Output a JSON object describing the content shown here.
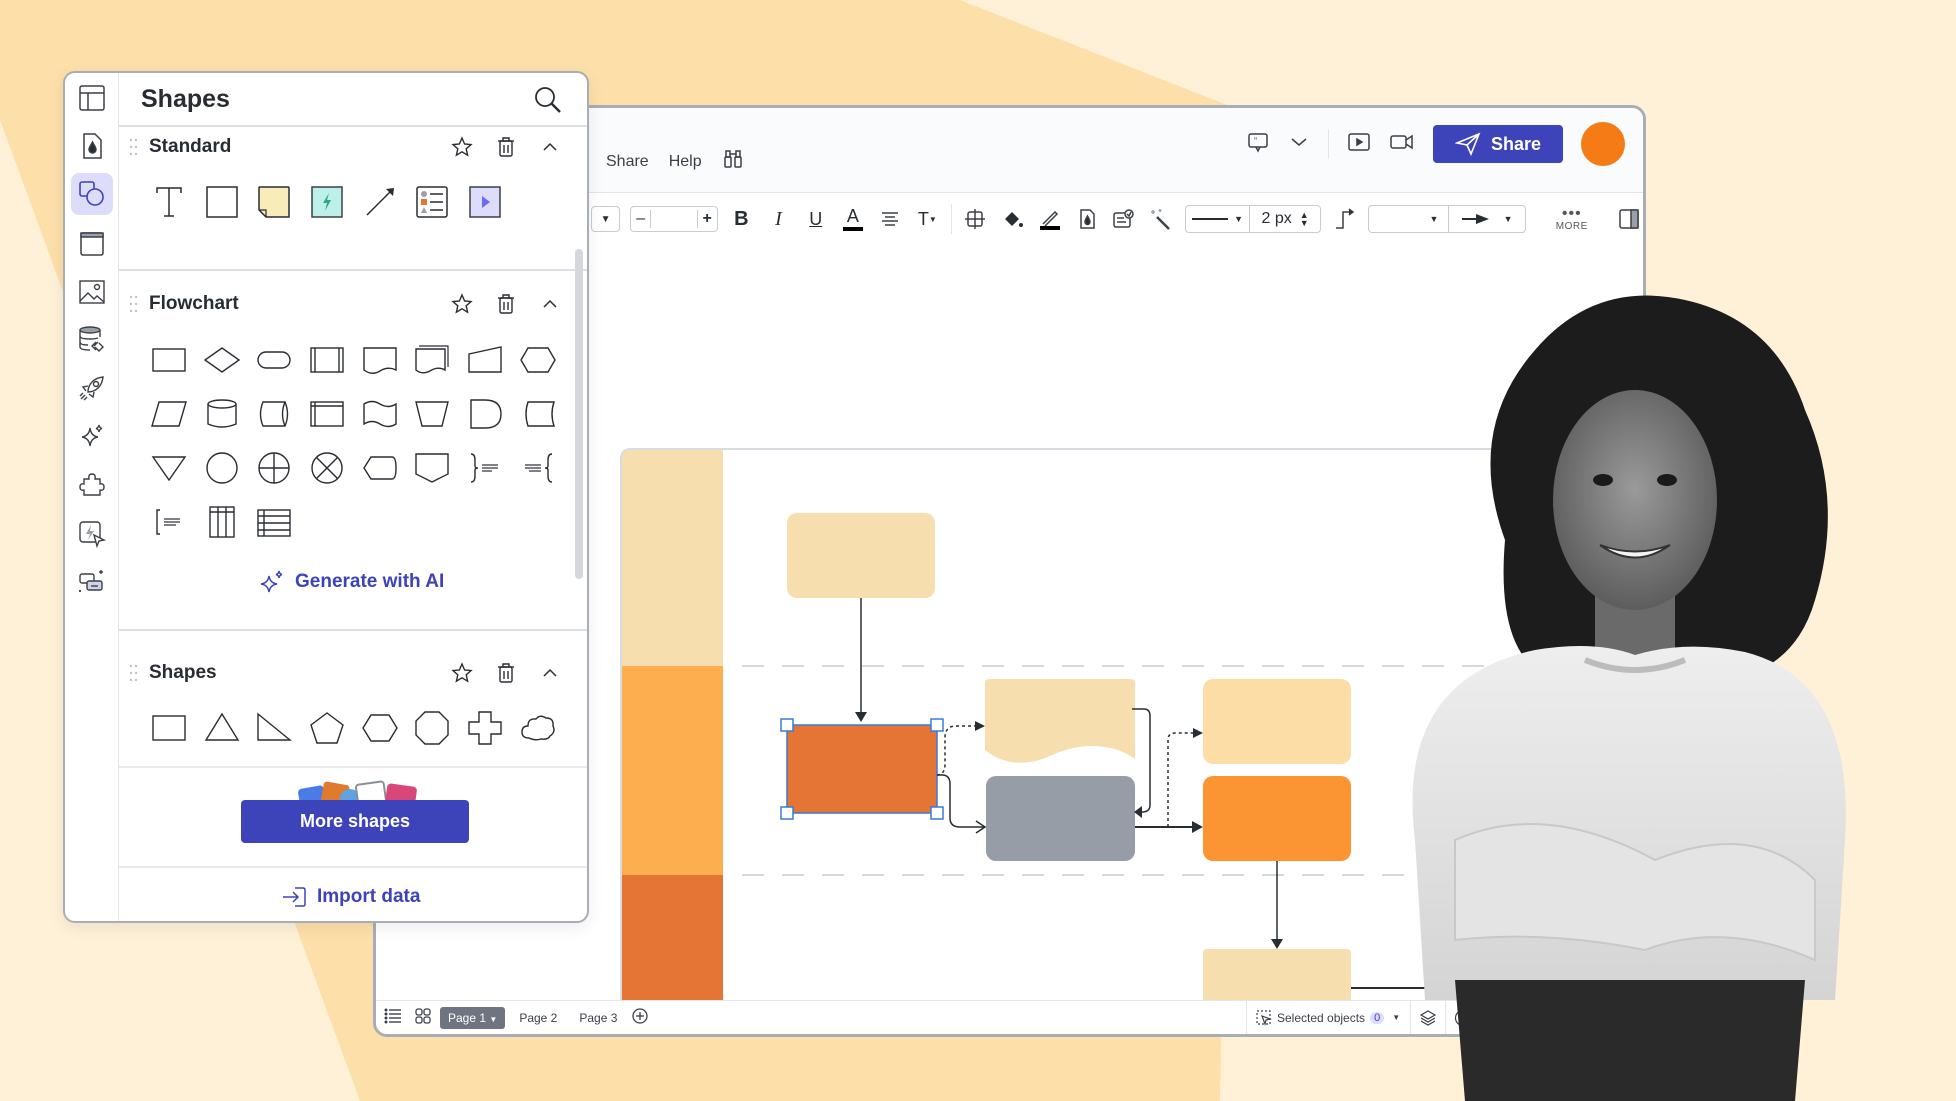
{
  "background": {
    "colors": {
      "base": "#FEF1D8",
      "stripe": "#FDDFA9"
    }
  },
  "shapes_panel": {
    "title": "Shapes",
    "search_icon": "search-icon",
    "rail_items": [
      {
        "icon": "layout-icon",
        "active": false
      },
      {
        "icon": "theme-drop-icon",
        "active": false
      },
      {
        "icon": "shapes-icon",
        "active": true
      },
      {
        "icon": "frame-icon",
        "active": false
      },
      {
        "icon": "image-icon",
        "active": false
      },
      {
        "icon": "data-link-icon",
        "active": false
      },
      {
        "icon": "rocket-icon",
        "active": false
      },
      {
        "icon": "sparkle-icon",
        "active": false
      },
      {
        "icon": "puzzle-icon",
        "active": false
      },
      {
        "icon": "quick-action-icon",
        "active": false
      },
      {
        "icon": "ai-chat-icon",
        "active": false
      }
    ],
    "sections": [
      {
        "title": "Standard",
        "shapes": [
          "text",
          "rectangle",
          "sticky-note",
          "action-block",
          "arrow",
          "list-card",
          "video-block"
        ]
      },
      {
        "title": "Flowchart",
        "shapes": [
          "process",
          "decision",
          "terminator",
          "predefined-process",
          "document",
          "multiple-documents",
          "manual-input",
          "preparation",
          "data",
          "database",
          "direct-access-storage",
          "internal-storage",
          "paper-tape",
          "manual-operation",
          "delay",
          "stored-data",
          "merge",
          "connector",
          "or",
          "summing-junction",
          "display",
          "off-page-link",
          "annotation-right",
          "annotation-left",
          "annotation",
          "table-columns",
          "table-rows"
        ],
        "generate_label": "Generate with AI"
      },
      {
        "title": "Shapes",
        "shapes": [
          "rectangle",
          "triangle",
          "right-triangle",
          "pentagon",
          "hexagon",
          "octagon",
          "cross",
          "cloud"
        ]
      }
    ],
    "more_shapes_label": "More shapes",
    "import_data_label": "Import data"
  },
  "main_window": {
    "menu": [
      "Share",
      "Help"
    ],
    "share_button": "Share",
    "avatar_color": "#F57B16",
    "toolbar": {
      "line_width": "2 px",
      "more_label": "MORE"
    },
    "bottom_bar": {
      "pages": [
        "Page 1",
        "Page 2",
        "Page 3"
      ],
      "active_page": "Page 1",
      "selected_objects_label": "Selected objects",
      "selected_count": "0"
    }
  },
  "diagram": {
    "lane_colors": [
      "#F7DEAE",
      "#FDAF50",
      "#E57534"
    ],
    "shape_colors": {
      "light": "#F7DEAE",
      "light2": "#FCDDA6",
      "selected": "#E57534",
      "gray": "#979DA6",
      "orange": "#FB9432",
      "selection": "#3A7BD5"
    }
  }
}
